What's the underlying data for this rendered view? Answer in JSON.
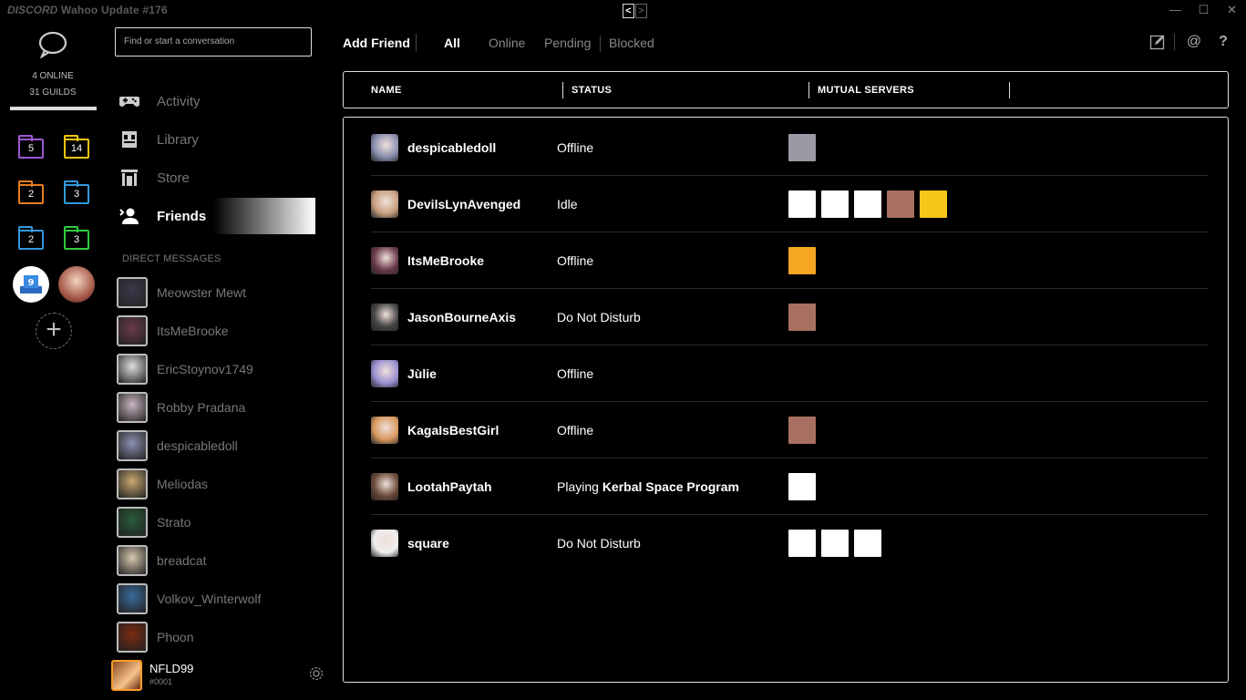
{
  "window": {
    "brand": "DISCORD",
    "title": "Wahoo Update #176",
    "back_arrow": "<",
    "forward_arrow": ">",
    "controls": [
      "—",
      "☐",
      "✕"
    ]
  },
  "guilds": {
    "online": "4 ONLINE",
    "count": "31 GUILDS",
    "folders": [
      {
        "count": "5",
        "color": "#9b59d0"
      },
      {
        "count": "14",
        "color": "#f1c40f"
      },
      {
        "count": "2",
        "color": "#e67e22"
      },
      {
        "count": "3",
        "color": "#3498db"
      },
      {
        "count": "2",
        "color": "#3498db"
      },
      {
        "count": "3",
        "color": "#2ecc40"
      }
    ],
    "add_symbol": "+"
  },
  "sidebar": {
    "search_placeholder": "Find or start a conversation",
    "nav": [
      {
        "label": "Activity",
        "icon": "gamepad-icon"
      },
      {
        "label": "Library",
        "icon": "library-icon"
      },
      {
        "label": "Store",
        "icon": "store-icon"
      },
      {
        "label": "Friends",
        "icon": "friends-icon"
      }
    ],
    "dm_header": "DIRECT MESSAGES",
    "dms": [
      {
        "name": "Meowster Mewt",
        "color": "#3a3a4a"
      },
      {
        "name": "ItsMeBrooke",
        "color": "#6a3a4a"
      },
      {
        "name": "EricStoynov1749",
        "color": "#dddddd"
      },
      {
        "name": "Robby Pradana",
        "color": "#c9b5c0"
      },
      {
        "name": "despicabledoll",
        "color": "#8a90b0"
      },
      {
        "name": "Meliodas",
        "color": "#c8a870"
      },
      {
        "name": "Strato",
        "color": "#2a5a3a"
      },
      {
        "name": "breadcat",
        "color": "#d8c8b0"
      },
      {
        "name": "Volkov_Winterwolf",
        "color": "#3a6a9a"
      },
      {
        "name": "Phoon",
        "color": "#7a2a10"
      }
    ],
    "user": {
      "name": "NFLD99",
      "tag": "#0001"
    }
  },
  "header": {
    "add_friend": "Add Friend",
    "tabs": [
      "All",
      "Online",
      "Pending",
      "Blocked"
    ],
    "active_tab": "All"
  },
  "table": {
    "columns": [
      "NAME",
      "STATUS",
      "MUTUAL SERVERS"
    ],
    "rows": [
      {
        "name": "despicabledoll",
        "status": "Offline",
        "status_game": "",
        "avatar": "#8a90b0",
        "servers": [
          "#9a9aa5"
        ]
      },
      {
        "name": "DevilsLynAvenged",
        "status": "Idle",
        "status_game": "",
        "avatar": "#c9a080",
        "servers": [
          "#ffffff",
          "#ffffff",
          "#ffffff",
          "#a87060",
          "#f5c518"
        ]
      },
      {
        "name": "ItsMeBrooke",
        "status": "Offline",
        "status_game": "",
        "avatar": "#6a3a4a",
        "servers": [
          "#f5a623",
          "#000000"
        ]
      },
      {
        "name": "JasonBourneAxis",
        "status": "Do Not Disturb",
        "status_game": "",
        "avatar": "#444444",
        "servers": [
          "#a87060"
        ]
      },
      {
        "name": "Jùlie",
        "status": "Offline",
        "status_game": "",
        "avatar": "#9a90d0",
        "servers": []
      },
      {
        "name": "KagaIsBestGirl",
        "status": "Offline",
        "status_game": "",
        "avatar": "#d89860",
        "servers": [
          "#a87060"
        ]
      },
      {
        "name": "LootahPaytah",
        "status": "Playing ",
        "status_game": "Kerbal Space Program",
        "avatar": "#6a4a3a",
        "servers": [
          "#ffffff",
          "#000000"
        ]
      },
      {
        "name": "square",
        "status": "Do Not Disturb",
        "status_game": "",
        "avatar": "#eeeeee",
        "servers": [
          "#ffffff",
          "#ffffff",
          "#ffffff"
        ]
      }
    ]
  }
}
